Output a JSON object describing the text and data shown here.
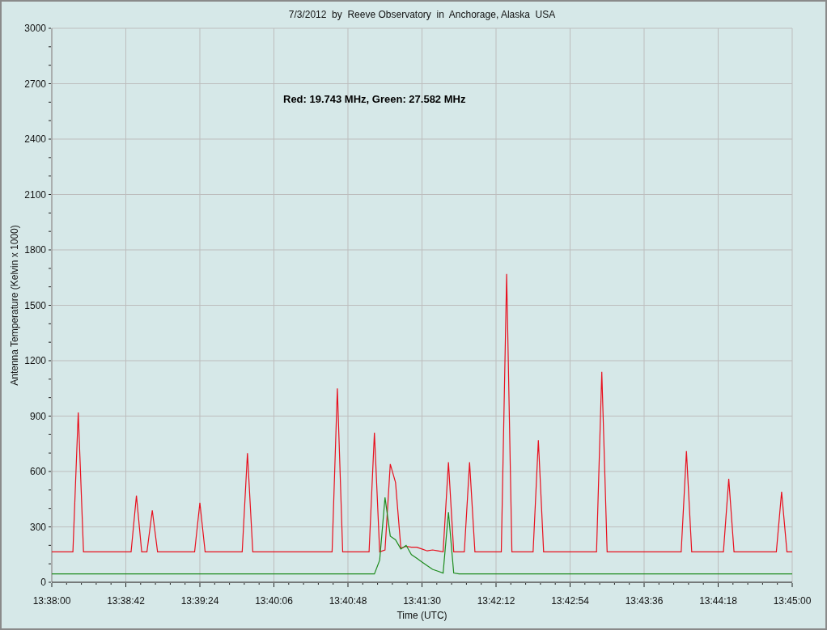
{
  "chart_data": {
    "type": "line",
    "title": "7/3/2012  by  Reeve Observatory  in  Anchorage, Alaska  USA",
    "xlabel": "Time (UTC)",
    "ylabel": "Antenna Temperature (Kelvin x 1000)",
    "categories": [
      "13:38:00",
      null,
      null,
      null,
      null,
      null,
      null,
      null,
      null,
      null,
      null,
      null,
      null,
      null,
      "13:38:42",
      null,
      null,
      null,
      null,
      null,
      null,
      null,
      null,
      null,
      null,
      null,
      null,
      null,
      "13:39:24",
      null,
      null,
      null,
      null,
      null,
      null,
      null,
      null,
      null,
      null,
      null,
      null,
      null,
      "13:40:06",
      null,
      null,
      null,
      null,
      null,
      null,
      null,
      null,
      null,
      null,
      null,
      null,
      null,
      "13:40:48",
      null,
      null,
      null,
      null,
      null,
      null,
      null,
      null,
      null,
      null,
      null,
      null,
      null,
      "13:41:30",
      null,
      null,
      null,
      null,
      null,
      null,
      null,
      null,
      null,
      null,
      null,
      null,
      null,
      "13:42:12",
      null,
      null,
      null,
      null,
      null,
      null,
      null,
      null,
      null,
      null,
      null,
      null,
      null,
      "13:42:54",
      null,
      null,
      null,
      null,
      null,
      null,
      null,
      null,
      null,
      null,
      null,
      null,
      null,
      "13:43:36",
      null,
      null,
      null,
      null,
      null,
      null,
      null,
      null,
      null,
      null,
      null,
      null,
      null,
      "13:44:18",
      null,
      null,
      null,
      null,
      null,
      null,
      null,
      null,
      null,
      null,
      null,
      null,
      null,
      "13:45:00"
    ],
    "series": [
      {
        "color": "#e8101e",
        "values": [
          165,
          165,
          165,
          165,
          165,
          920,
          165,
          165,
          165,
          165,
          165,
          165,
          165,
          165,
          165,
          165,
          470,
          165,
          165,
          390,
          165,
          165,
          165,
          165,
          165,
          165,
          165,
          165,
          430,
          165,
          165,
          165,
          165,
          165,
          165,
          165,
          165,
          700,
          165,
          165,
          165,
          165,
          165,
          165,
          165,
          165,
          165,
          165,
          165,
          165,
          165,
          165,
          165,
          165,
          1050,
          165,
          165,
          165,
          165,
          165,
          165,
          810,
          165,
          175,
          640,
          540,
          185,
          195,
          190,
          190,
          180,
          170,
          175,
          170,
          165,
          650,
          165,
          165,
          165,
          650,
          165,
          165,
          165,
          165,
          165,
          165,
          1670,
          165,
          165,
          165,
          165,
          165,
          770,
          165,
          165,
          165,
          165,
          165,
          165,
          165,
          165,
          165,
          165,
          165,
          1140,
          165,
          165,
          165,
          165,
          165,
          165,
          165,
          165,
          165,
          165,
          165,
          165,
          165,
          165,
          165,
          710,
          165,
          165,
          165,
          165,
          165,
          165,
          165,
          560,
          165,
          165,
          165,
          165,
          165,
          165,
          165,
          165,
          165,
          490,
          165,
          165
        ]
      },
      {
        "color": "#1e8c1e",
        "values": [
          45,
          45,
          45,
          45,
          45,
          45,
          45,
          45,
          45,
          45,
          45,
          45,
          45,
          45,
          45,
          45,
          45,
          45,
          45,
          45,
          45,
          45,
          45,
          45,
          45,
          45,
          45,
          45,
          45,
          45,
          45,
          45,
          45,
          45,
          45,
          45,
          45,
          45,
          45,
          45,
          45,
          45,
          45,
          45,
          45,
          45,
          45,
          45,
          45,
          45,
          45,
          45,
          45,
          45,
          45,
          45,
          45,
          45,
          45,
          45,
          45,
          45,
          120,
          460,
          250,
          230,
          180,
          200,
          150,
          130,
          110,
          90,
          70,
          60,
          50,
          380,
          50,
          45,
          45,
          45,
          45,
          45,
          45,
          45,
          45,
          45,
          45,
          45,
          45,
          45,
          45,
          45,
          45,
          45,
          45,
          45,
          45,
          45,
          45,
          45,
          45,
          45,
          45,
          45,
          45,
          45,
          45,
          45,
          45,
          45,
          45,
          45,
          45,
          45,
          45,
          45,
          45,
          45,
          45,
          45,
          45,
          45,
          45,
          45,
          45,
          45,
          45,
          45,
          45,
          45,
          45,
          45,
          45,
          45,
          45,
          45,
          45,
          45,
          45,
          45,
          45
        ]
      }
    ],
    "grid": true,
    "ylim": [
      0,
      3000
    ],
    "yticks": [
      0,
      300,
      600,
      900,
      1200,
      1500,
      1800,
      2100,
      2400,
      2700,
      3000
    ],
    "annotations": [
      "Red: 19.743 MHz, Green: 27.582 MHz"
    ]
  }
}
